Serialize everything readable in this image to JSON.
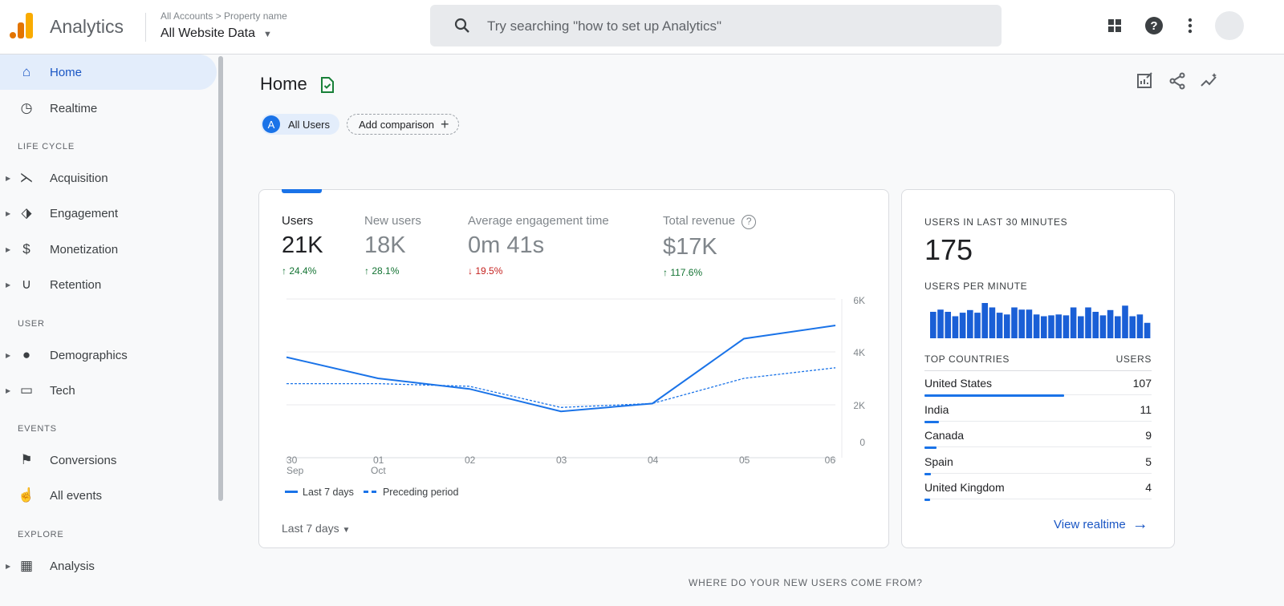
{
  "header": {
    "app_title": "Analytics",
    "breadcrumb": "All Accounts > Property name",
    "property": "All Website Data",
    "search_placeholder": "Try searching \"how to set up Analytics\""
  },
  "sidebar": {
    "items": [
      {
        "label": "Home",
        "icon": "home-icon"
      },
      {
        "label": "Realtime",
        "icon": "clock-icon"
      },
      {
        "label": "Acquisition",
        "icon": "acquisition-icon"
      },
      {
        "label": "Engagement",
        "icon": "tag-icon"
      },
      {
        "label": "Monetization",
        "icon": "dollar-icon"
      },
      {
        "label": "Retention",
        "icon": "magnet-icon"
      },
      {
        "label": "Demographics",
        "icon": "globe-icon"
      },
      {
        "label": "Tech",
        "icon": "devices-icon"
      },
      {
        "label": "Conversions",
        "icon": "flag-icon"
      },
      {
        "label": "All events",
        "icon": "touch-icon"
      },
      {
        "label": "Analysis",
        "icon": "analysis-icon"
      }
    ],
    "sections": [
      "LIFE CYCLE",
      "USER",
      "EVENTS",
      "EXPLORE"
    ]
  },
  "main": {
    "title": "Home",
    "segment": {
      "letter": "A",
      "label": "All Users"
    },
    "add_comparison": "Add comparison",
    "metrics": [
      {
        "label": "Users",
        "value": "21K",
        "delta": "24.4%",
        "dir": "up"
      },
      {
        "label": "New users",
        "value": "18K",
        "delta": "28.1%",
        "dir": "up"
      },
      {
        "label": "Average engagement time",
        "value": "0m 41s",
        "delta": "19.5%",
        "dir": "down"
      },
      {
        "label": "Total revenue",
        "value": "$17K",
        "delta": "117.6%",
        "dir": "up"
      }
    ],
    "period": "Last 7 days",
    "bottom_heading": "WHERE DO YOUR NEW USERS COME FROM?"
  },
  "chart_data": {
    "type": "line",
    "x": [
      "30 Sep",
      "01 Oct",
      "02",
      "03",
      "04",
      "05",
      "06"
    ],
    "x_tick_top": [
      "30",
      "01",
      "02",
      "03",
      "04",
      "05",
      "06"
    ],
    "x_tick_bottom": [
      "Sep",
      "Oct",
      "",
      "",
      "",
      "",
      ""
    ],
    "y_ticks": [
      "6K",
      "4K",
      "2K",
      "0"
    ],
    "ylim": [
      0,
      6000
    ],
    "series": [
      {
        "name": "Last 7 days",
        "style": "solid",
        "values": [
          3800,
          3000,
          2600,
          1750,
          2050,
          4500,
          5000
        ]
      },
      {
        "name": "Preceding period",
        "style": "dashed",
        "values": [
          2800,
          2800,
          2700,
          1900,
          2050,
          3000,
          3400
        ]
      }
    ],
    "legend": "bottom-left",
    "color": "#1a73e8"
  },
  "realtime": {
    "title": "USERS IN LAST 30 MINUTES",
    "value": "175",
    "per_minute_label": "USERS PER MINUTE",
    "per_minute": [
      6,
      6.5,
      6,
      5,
      5.8,
      6.4,
      5.8,
      8,
      7,
      5.8,
      5.4,
      7,
      6.5,
      6.5,
      5.4,
      5,
      5.2,
      5.4,
      5.2,
      7,
      5,
      7,
      6,
      5.2,
      6.4,
      5,
      7.4,
      5,
      5.4,
      3.5
    ],
    "countries_header": "TOP COUNTRIES",
    "users_header": "USERS",
    "countries": [
      {
        "name": "United States",
        "users": "107",
        "count": 107
      },
      {
        "name": "India",
        "users": "11",
        "count": 11
      },
      {
        "name": "Canada",
        "users": "9",
        "count": 9
      },
      {
        "name": "Spain",
        "users": "5",
        "count": 5
      },
      {
        "name": "United Kingdom",
        "users": "4",
        "count": 4
      }
    ],
    "view_link": "View realtime"
  }
}
